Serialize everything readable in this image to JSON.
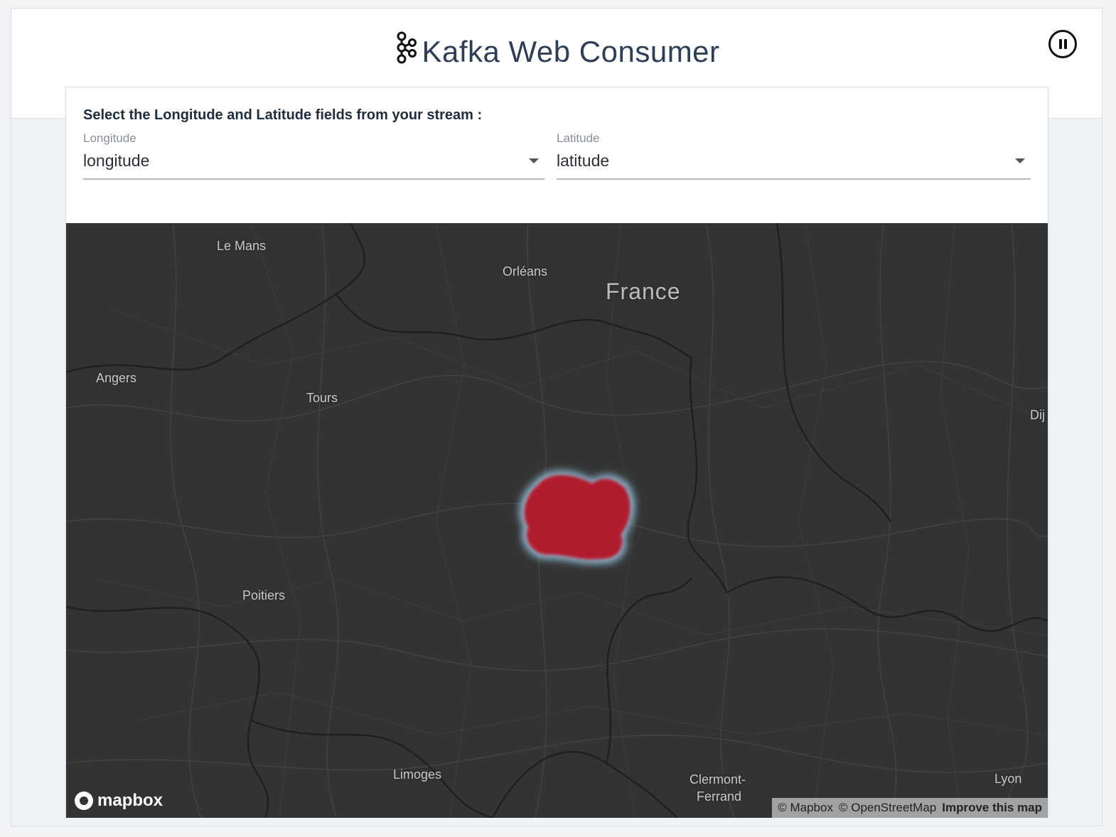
{
  "app": {
    "title": "Kafka Web Consumer",
    "pause_icon": "pause-circle-icon",
    "logo_icon": "kafka-logo-icon"
  },
  "form": {
    "prompt": "Select the Longitude and Latitude fields from your stream :",
    "longitude": {
      "label": "Longitude",
      "value": "longitude"
    },
    "latitude": {
      "label": "Latitude",
      "value": "latitude"
    }
  },
  "map": {
    "country": "France",
    "cities": {
      "le_mans": "Le Mans",
      "orleans": "Orléans",
      "angers": "Angers",
      "tours": "Tours",
      "dijon": "Dij",
      "poitiers": "Poitiers",
      "limoges": "Limoges",
      "clermont_1": "Clermont-",
      "clermont_2": "Ferrand",
      "lyon": "Lyon"
    },
    "logo": "mapbox",
    "attribution": {
      "mapbox": "© Mapbox",
      "osm": "© OpenStreetMap",
      "improve": "Improve this map"
    },
    "heat_color": "#b01c2e",
    "background_color": "#333333"
  }
}
